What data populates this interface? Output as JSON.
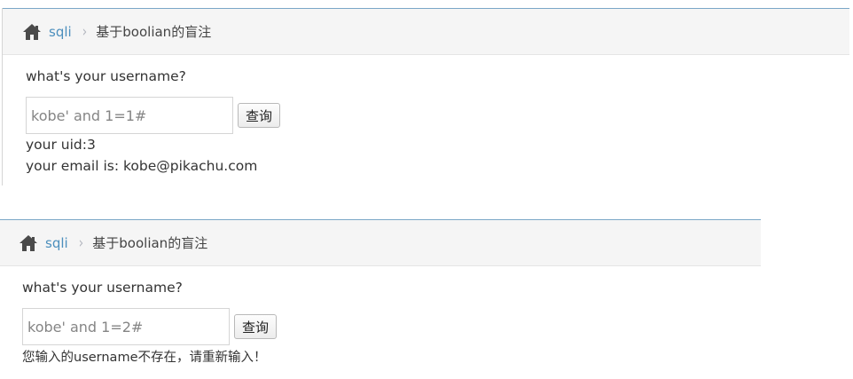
{
  "panels": [
    {
      "breadcrumb": {
        "home_icon": "home-icon",
        "link": "sqli",
        "current": "基于boolian的盲注"
      },
      "question": "what's your username?",
      "input_value": "kobe' and 1=1#",
      "button_label": "查询",
      "results": [
        "your uid:3",
        "your email is: kobe@pikachu.com"
      ]
    },
    {
      "breadcrumb": {
        "home_icon": "home-icon",
        "link": "sqli",
        "current": "基于boolian的盲注"
      },
      "question": "what's your username?",
      "input_value": "kobe' and 1=2#",
      "button_label": "查询",
      "error": "您输入的username不存在，请重新输入！"
    }
  ],
  "colors": {
    "link": "#4c8fbd",
    "breadcrumb_bg": "#f5f5f5",
    "top_border": "#7aa7c7"
  }
}
